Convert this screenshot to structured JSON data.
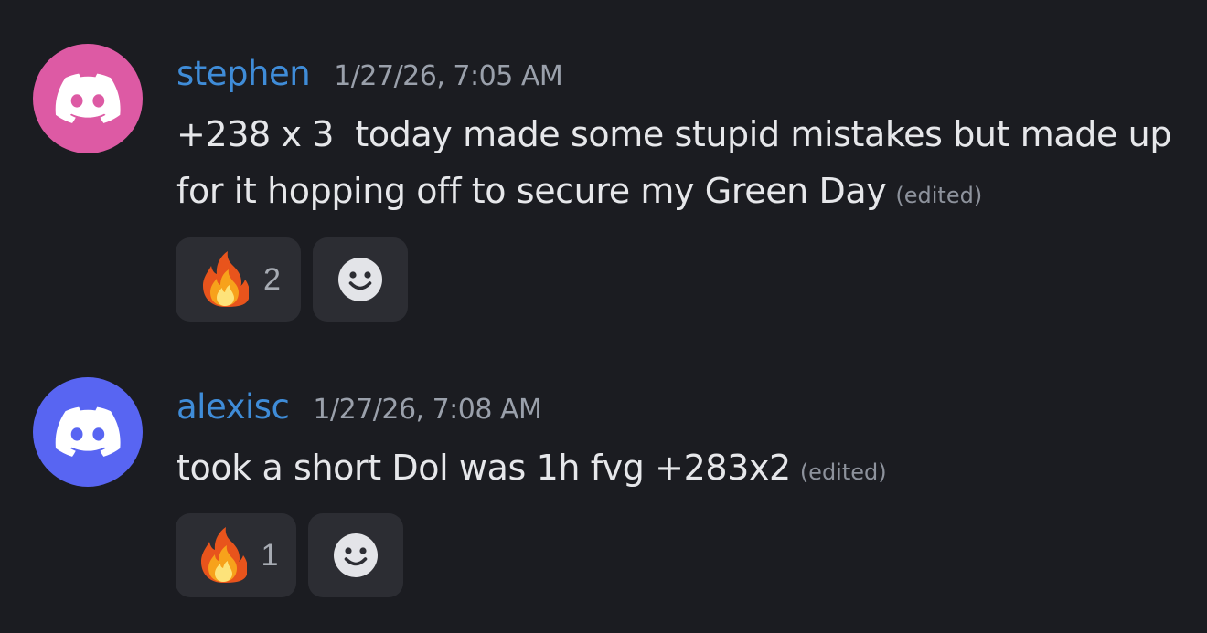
{
  "colors": {
    "background": "#1b1c21",
    "username": "#3f8cd8",
    "reaction_bg": "#2c2d33"
  },
  "messages": [
    {
      "username": "stephen",
      "timestamp": "1/27/26, 7:05 AM",
      "avatar_color": "#dd5aa4",
      "avatar_icon": "discord-icon",
      "content": "+238 x 3  today made some stupid mistakes but made up for it hopping off to secure my Green Day",
      "edited_label": "(edited)",
      "reactions": [
        {
          "emoji": "fire-icon",
          "count": "2"
        }
      ],
      "add_reaction_icon": "smile-icon"
    },
    {
      "username": "alexisc",
      "timestamp": "1/27/26, 7:08 AM",
      "avatar_color": "#5865f2",
      "avatar_icon": "discord-icon",
      "content": "took a short Dol was 1h fvg +283x2",
      "edited_label": "(edited)",
      "reactions": [
        {
          "emoji": "fire-icon",
          "count": "1"
        }
      ],
      "add_reaction_icon": "smile-icon"
    }
  ]
}
